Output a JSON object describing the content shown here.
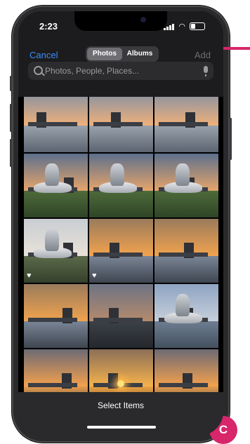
{
  "status_bar": {
    "time": "2:23"
  },
  "nav": {
    "cancel_label": "Cancel",
    "tabs": [
      {
        "label": "Photos",
        "active": true
      },
      {
        "label": "Albums",
        "active": false
      }
    ],
    "add_label": "Add"
  },
  "search": {
    "placeholder": "Photos, People, Places..."
  },
  "grid": {
    "photos": [
      {
        "theme": "sunset-lake",
        "favorite": false
      },
      {
        "theme": "sunset-lake",
        "favorite": false
      },
      {
        "theme": "sunset-lake",
        "favorite": false
      },
      {
        "theme": "museum-dusk",
        "favorite": false
      },
      {
        "theme": "museum-dusk",
        "favorite": false
      },
      {
        "theme": "museum-dusk",
        "favorite": false
      },
      {
        "theme": "museum-day",
        "favorite": true
      },
      {
        "theme": "sunset-orange",
        "favorite": true
      },
      {
        "theme": "sunset-orange",
        "favorite": false
      },
      {
        "theme": "sunset-orange",
        "favorite": false
      },
      {
        "theme": "dusk-dark",
        "favorite": false
      },
      {
        "theme": "harbor",
        "favorite": false
      },
      {
        "theme": "bridge-sunset",
        "favorite": false
      },
      {
        "theme": "sunset-sun",
        "favorite": false
      },
      {
        "theme": "bridge-sunset",
        "favorite": false
      }
    ]
  },
  "bottom": {
    "select_label": "Select Items"
  },
  "callout": {
    "badge_label": "C",
    "accent": "#d7266a"
  }
}
